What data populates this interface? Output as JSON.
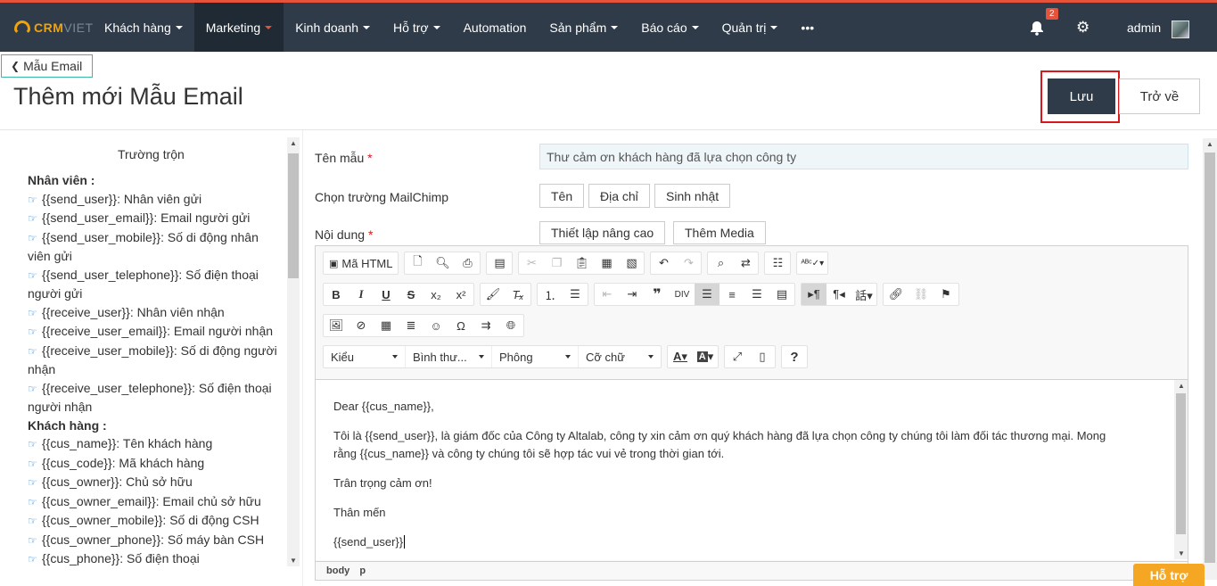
{
  "nav": {
    "logo": {
      "brand": "CRM",
      "suffix": "VIET"
    },
    "items": [
      {
        "label": "Khách hàng",
        "caret": true
      },
      {
        "label": "Marketing",
        "caret": true,
        "active": true
      },
      {
        "label": "Kinh doanh",
        "caret": true
      },
      {
        "label": "Hỗ trợ",
        "caret": true
      },
      {
        "label": "Automation",
        "caret": false
      },
      {
        "label": "Sản phẩm",
        "caret": true
      },
      {
        "label": "Báo cáo",
        "caret": true
      },
      {
        "label": "Quản trị",
        "caret": true
      },
      {
        "label": "•••",
        "caret": false
      }
    ],
    "notification_count": "2",
    "user": "admin"
  },
  "header": {
    "back_label": "Mẫu Email",
    "title": "Thêm mới Mẫu Email",
    "save_label": "Lưu",
    "return_label": "Trở về"
  },
  "merge": {
    "title": "Trường trộn",
    "lines": [
      {
        "type": "group",
        "text": "Nhân viên :"
      },
      {
        "type": "item",
        "text": "{{send_user}}: Nhân viên gửi"
      },
      {
        "type": "item",
        "text": "{{send_user_email}}: Email người gửi"
      },
      {
        "type": "item",
        "text": "{{send_user_mobile}}: Số di động nhân viên gửi"
      },
      {
        "type": "item",
        "text": "{{send_user_telephone}}: Số điện thoại người gửi"
      },
      {
        "type": "item",
        "text": "{{receive_user}}: Nhân viên nhận"
      },
      {
        "type": "item",
        "text": "{{receive_user_email}}: Email người nhận"
      },
      {
        "type": "item",
        "text": "{{receive_user_mobile}}: Số di động người nhận"
      },
      {
        "type": "item",
        "text": "{{receive_user_telephone}}: Số điện thoại người nhận"
      },
      {
        "type": "group",
        "text": "Khách hàng :"
      },
      {
        "type": "item",
        "text": "{{cus_name}}: Tên khách hàng"
      },
      {
        "type": "item",
        "text": "{{cus_code}}: Mã khách hàng"
      },
      {
        "type": "item",
        "text": "{{cus_owner}}: Chủ sở hữu"
      },
      {
        "type": "item",
        "text": "{{cus_owner_email}}: Email chủ sở hữu"
      },
      {
        "type": "item",
        "text": "{{cus_owner_mobile}}: Số di động CSH"
      },
      {
        "type": "item",
        "text": "{{cus_owner_phone}}: Số máy bàn CSH"
      },
      {
        "type": "item",
        "text": "{{cus_phone}}: Số điện thoại"
      }
    ]
  },
  "form": {
    "name_label": "Tên mẫu",
    "name_value": "Thư cảm ơn khách hàng đã lựa chọn công ty",
    "mailchimp_label": "Chọn trường MailChimp",
    "mailchimp_buttons": [
      "Tên",
      "Địa chỉ",
      "Sinh nhật"
    ],
    "content_label": "Nội dung",
    "advanced_label": "Thiết lập nâng cao",
    "media_label": "Thêm Media",
    "required_mark": "*"
  },
  "editor": {
    "source_label": "Mã HTML",
    "style_combo": "Kiểu",
    "format_combo": "Bình thư...",
    "font_combo": "Phông",
    "size_combo": "Cỡ chữ",
    "help_label": "?",
    "paragraphs": [
      "Dear {{cus_name}},",
      "Tôi là {{send_user}}, là giám đốc của Công ty Altalab, công ty xin cảm ơn quý khách hàng đã lựa chọn công ty chúng tôi làm đối tác thương mại. Mong rằng {{cus_name}} và công ty chúng tôi sẽ hợp tác vui vẻ trong thời gian tới.",
      "Trân trọng cảm ơn!",
      "Thân mến",
      "{{send_user}}"
    ],
    "path": [
      "body",
      "p"
    ]
  },
  "help_tab": "Hỗ trợ"
}
